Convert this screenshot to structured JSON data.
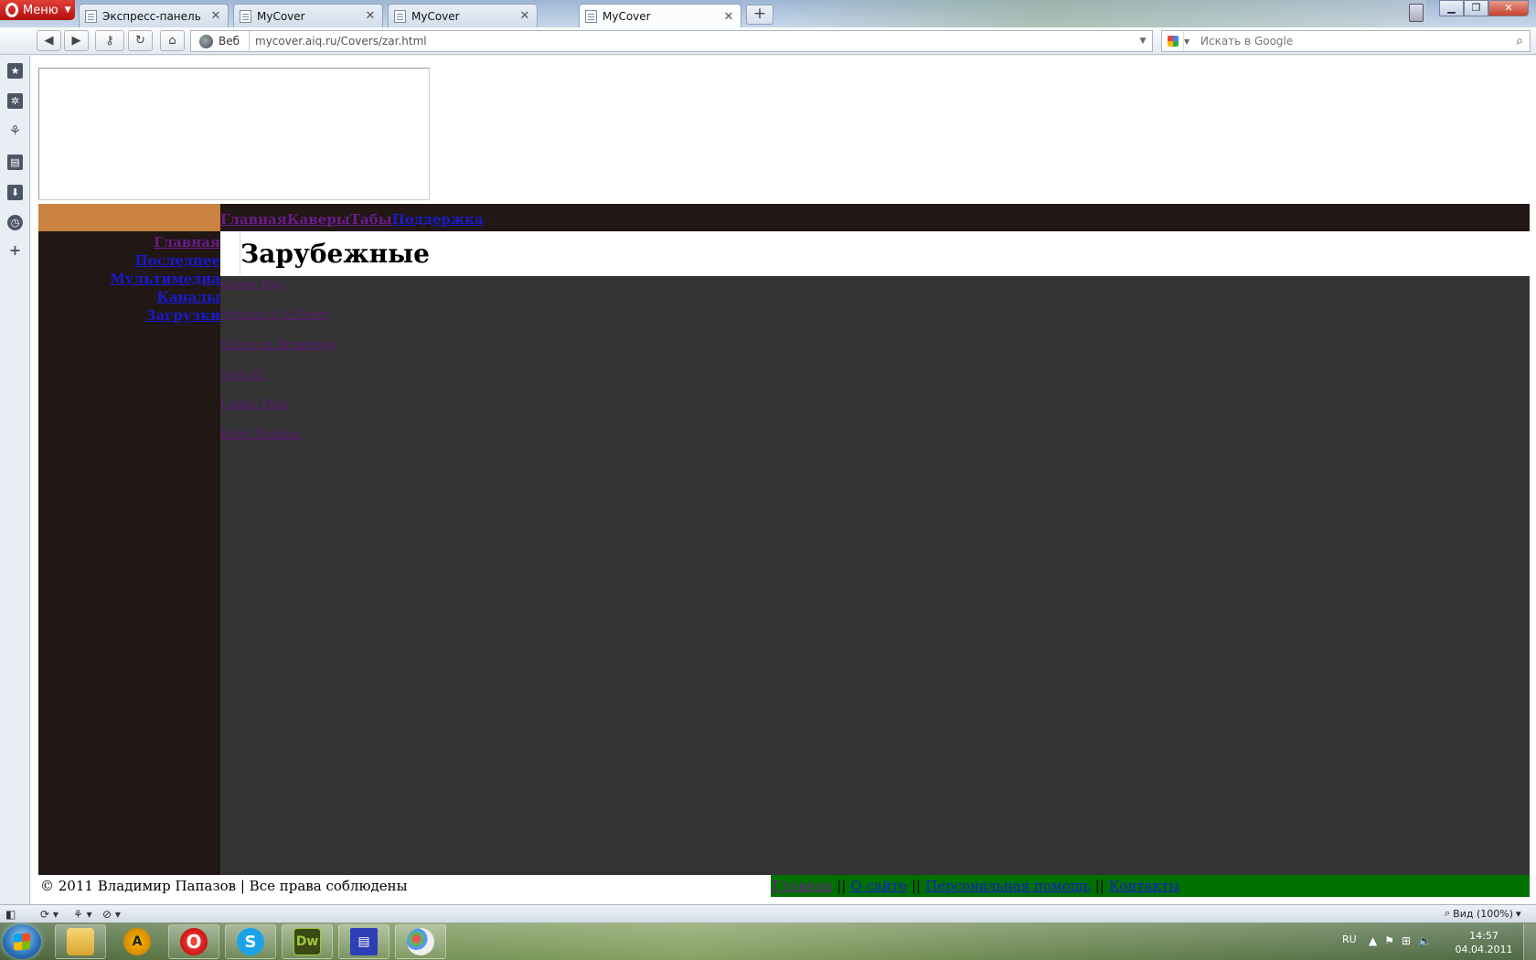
{
  "browser": {
    "menu_label": "Меню",
    "tabs": [
      {
        "title": "Экспресс-панель",
        "active": false
      },
      {
        "title": "MyCover",
        "active": false
      },
      {
        "title": "MyCover",
        "active": false
      },
      {
        "title": "MyCover",
        "active": true
      }
    ],
    "address": {
      "label": "Веб",
      "url": "mycover.aiq.ru/Covers/zar.html"
    },
    "search": {
      "placeholder": "Искать в Google"
    }
  },
  "site": {
    "topnav": [
      {
        "label": "Главная",
        "visited": true
      },
      {
        "label": "Каверы",
        "visited": true
      },
      {
        "label": "Табы",
        "visited": true
      },
      {
        "label": "Поддержка",
        "visited": false
      }
    ],
    "sidebar": [
      {
        "label": "Главная",
        "visited": true
      },
      {
        "label": "Последнее",
        "visited": false
      },
      {
        "label": "Мультимедиа",
        "visited": false
      },
      {
        "label": "Каналы",
        "visited": false
      },
      {
        "label": "Загрузки",
        "visited": false
      }
    ],
    "page_title": "Зарубежные",
    "bands": [
      "Green Day",
      "System of a Down",
      "Shine on Broadway",
      "Sum 41",
      "Linkin Park",
      "Korn Tankino"
    ],
    "footer": {
      "copyright": "© 2011 Владимир Папазов | Все права соблюдены",
      "links": [
        {
          "label": "Главная",
          "visited": true
        },
        {
          "label": "О сайте",
          "visited": false
        },
        {
          "label": "Персональная помощь",
          "visited": false
        },
        {
          "label": "Контакты",
          "visited": false
        }
      ],
      "separator": "||"
    }
  },
  "statusbar": {
    "zoom": "Вид (100%)"
  },
  "taskbar": {
    "language": "RU",
    "time": "14:57",
    "date": "04.04.2011"
  },
  "colors": {
    "dark_brown": "#211715",
    "orange": "#c98240",
    "content_gray": "#333333",
    "footer_green": "#007000",
    "visited_link": "#6a1b8a",
    "unvisited_link": "#1a1acc"
  }
}
